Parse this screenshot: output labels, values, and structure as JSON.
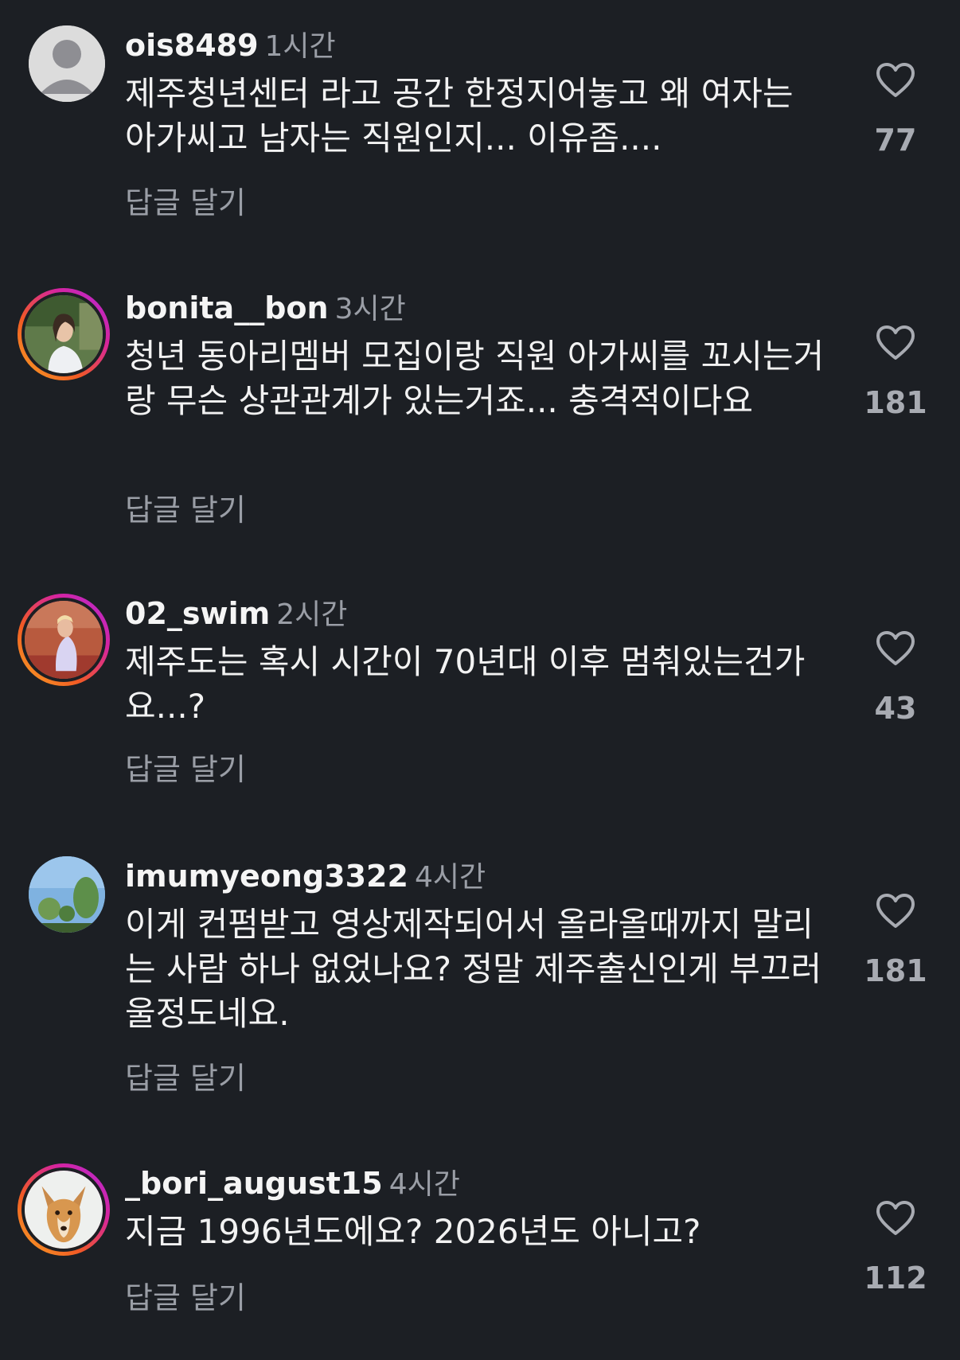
{
  "comments": [
    {
      "username": "ois8489",
      "time": "1시간",
      "text": "제주청년센터 라고 공간 한정지어놓고 왜 여자는 아가씨고 남자는 직원인지... 이유좀....",
      "reply": "답글 달기",
      "likes": "77",
      "avatar": "default-avatar-icon"
    },
    {
      "username": "bonita__bon",
      "time": "3시간",
      "text": "청년 동아리멤버 모집이랑 직원 아가씨를 꼬시는거랑 무슨 상관관계가 있는거죠... 충격적이다요",
      "reply": "답글 달기",
      "likes": "181",
      "avatar": "woman-photo"
    },
    {
      "username": "02_swim",
      "time": "2시간",
      "text": "제주도는 혹시 시간이 70년대 이후 멈춰있는건가요...?",
      "reply": "답글 달기",
      "likes": "43",
      "avatar": "swimmer-photo"
    },
    {
      "username": "imumyeong3322",
      "time": "4시간",
      "text": "이게 컨펌받고 영상제작되어서 올라올때까지 말리는 사람 하나 없었나요? 정말 제주출신인게 부끄러울정도네요.",
      "reply": "답글 달기",
      "likes": "181",
      "avatar": "trees-sky-photo"
    },
    {
      "username": "_bori_august15",
      "time": "4시간",
      "text": "지금 1996년도에요? 2026년도 아니고?",
      "reply": "답글 달기",
      "likes": "112",
      "avatar": "dog-photo"
    }
  ],
  "colors": {
    "background": "#1c1f24",
    "muted": "#9a9ea6",
    "ring_start": "#f9a825",
    "ring_end": "#b02bd9"
  }
}
